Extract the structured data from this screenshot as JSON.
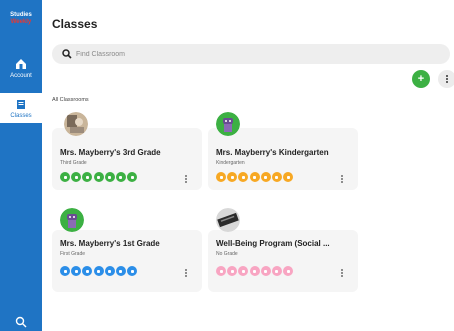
{
  "sidebar": {
    "logo_line1": "Studies",
    "logo_line2": "Weekly",
    "account_label": "Account",
    "classes_label": "Classes"
  },
  "page": {
    "title": "Classes",
    "search_placeholder": "Find Classroom",
    "add_button": "+",
    "section_label": "All Classrooms"
  },
  "classes": [
    {
      "name": "Mrs. Mayberry's 3rd Grade",
      "grade": "Third Grade",
      "icon_color": "#3cb043",
      "avatar": "photo-icon"
    },
    {
      "name": "Mrs. Mayberry's Kindergarten",
      "grade": "Kindergarten",
      "icon_color": "#f7a823",
      "avatar": "robot-icon"
    },
    {
      "name": "Mrs. Mayberry's 1st Grade",
      "grade": "First Grade",
      "icon_color": "#2b8ee8",
      "avatar": "robot-icon"
    },
    {
      "name": "Well-Being Program (Social ...",
      "grade": "No Grade",
      "icon_color": "#f8a5c2",
      "avatar": "keyboard-icon"
    }
  ],
  "colors": {
    "sidebar": "#1f74c4",
    "add": "#3cb043"
  }
}
